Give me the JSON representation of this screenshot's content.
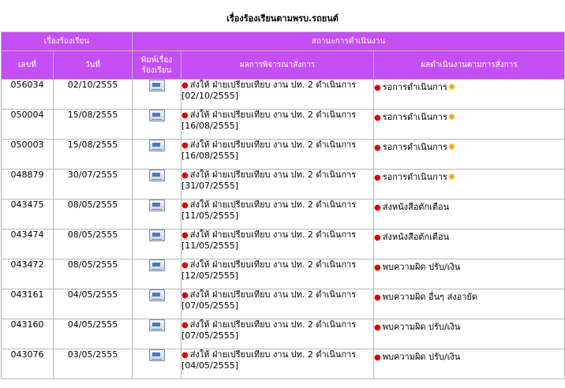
{
  "title": "เรื่องร้องเรียนตามพรบ.รถยนต์",
  "header": {
    "group_complaint": "เรื่องร้องเรียน",
    "group_status": "สถานะการดำเนินงาน",
    "col_no": "เลขที่",
    "col_date": "วันที่",
    "col_print_line1": "พิมพ์เรื่อง",
    "col_print_line2": "ร้องเรียน",
    "col_result": "ผลการพิจารณาสั่งการ",
    "col_status": "ผลดำเนินงานตามการสั่งการ"
  },
  "rows": [
    {
      "no": "056034",
      "date": "02/10/2555",
      "result": "ส่งให้ ฝ่ายเปรียบเทียบ งาน ปท. 2 ดำเนินการ",
      "result_date": "[02/10/2555]",
      "status": "รอการดำเนินการ",
      "status_icon": "flame-icon"
    },
    {
      "no": "050004",
      "date": "15/08/2555",
      "result": "ส่งให้ ฝ่ายเปรียบเทียบ งาน ปท. 2 ดำเนินการ",
      "result_date": "[16/08/2555]",
      "status": "รอการดำเนินการ",
      "status_icon": "flame-icon"
    },
    {
      "no": "050003",
      "date": "15/08/2555",
      "result": "ส่งให้ ฝ่ายเปรียบเทียบ งาน ปท. 2 ดำเนินการ",
      "result_date": "[16/08/2555]",
      "status": "รอการดำเนินการ",
      "status_icon": "flame-icon"
    },
    {
      "no": "048879",
      "date": "30/07/2555",
      "result": "ส่งให้ ฝ่ายเปรียบเทียบ งาน ปท. 2 ดำเนินการ",
      "result_date": "[31/07/2555]",
      "status": "รอการดำเนินการ",
      "status_icon": "flame-icon"
    },
    {
      "no": "043475",
      "date": "08/05/2555",
      "result": "ส่งให้ ฝ่ายเปรียบเทียบ งาน ปท. 2 ดำเนินการ",
      "result_date": "[11/05/2555]",
      "status": "ส่งหนังสือตักเตือน",
      "status_icon": ""
    },
    {
      "no": "043474",
      "date": "08/05/2555",
      "result": "ส่งให้ ฝ่ายเปรียบเทียบ งาน ปท. 2 ดำเนินการ",
      "result_date": "[11/05/2555]",
      "status": "ส่งหนังสือตักเตือน",
      "status_icon": ""
    },
    {
      "no": "043472",
      "date": "08/05/2555",
      "result": "ส่งให้ ฝ่ายเปรียบเทียบ งาน ปท. 2 ดำเนินการ",
      "result_date": "[12/05/2555]",
      "status": "พบความผิด ปรับ/เงิน",
      "status_icon": ""
    },
    {
      "no": "043161",
      "date": "04/05/2555",
      "result": "ส่งให้ ฝ่ายเปรียบเทียบ งาน ปท. 2 ดำเนินการ",
      "result_date": "[07/05/2555]",
      "status": "พบความผิด อื่นๆ ส่งอายัด",
      "status_icon": ""
    },
    {
      "no": "043160",
      "date": "04/05/2555",
      "result": "ส่งให้ ฝ่ายเปรียบเทียบ งาน ปท. 2 ดำเนินการ",
      "result_date": "[07/05/2555]",
      "status": "พบความผิด ปรับ/เงิน",
      "status_icon": ""
    },
    {
      "no": "043076",
      "date": "03/05/2555",
      "result": "ส่งให้ ฝ่ายเปรียบเทียบ งาน ปท. 2 ดำเนินการ",
      "result_date": "[04/05/2555]",
      "status": "พบความผิด ปรับ/เงิน",
      "status_icon": ""
    }
  ]
}
